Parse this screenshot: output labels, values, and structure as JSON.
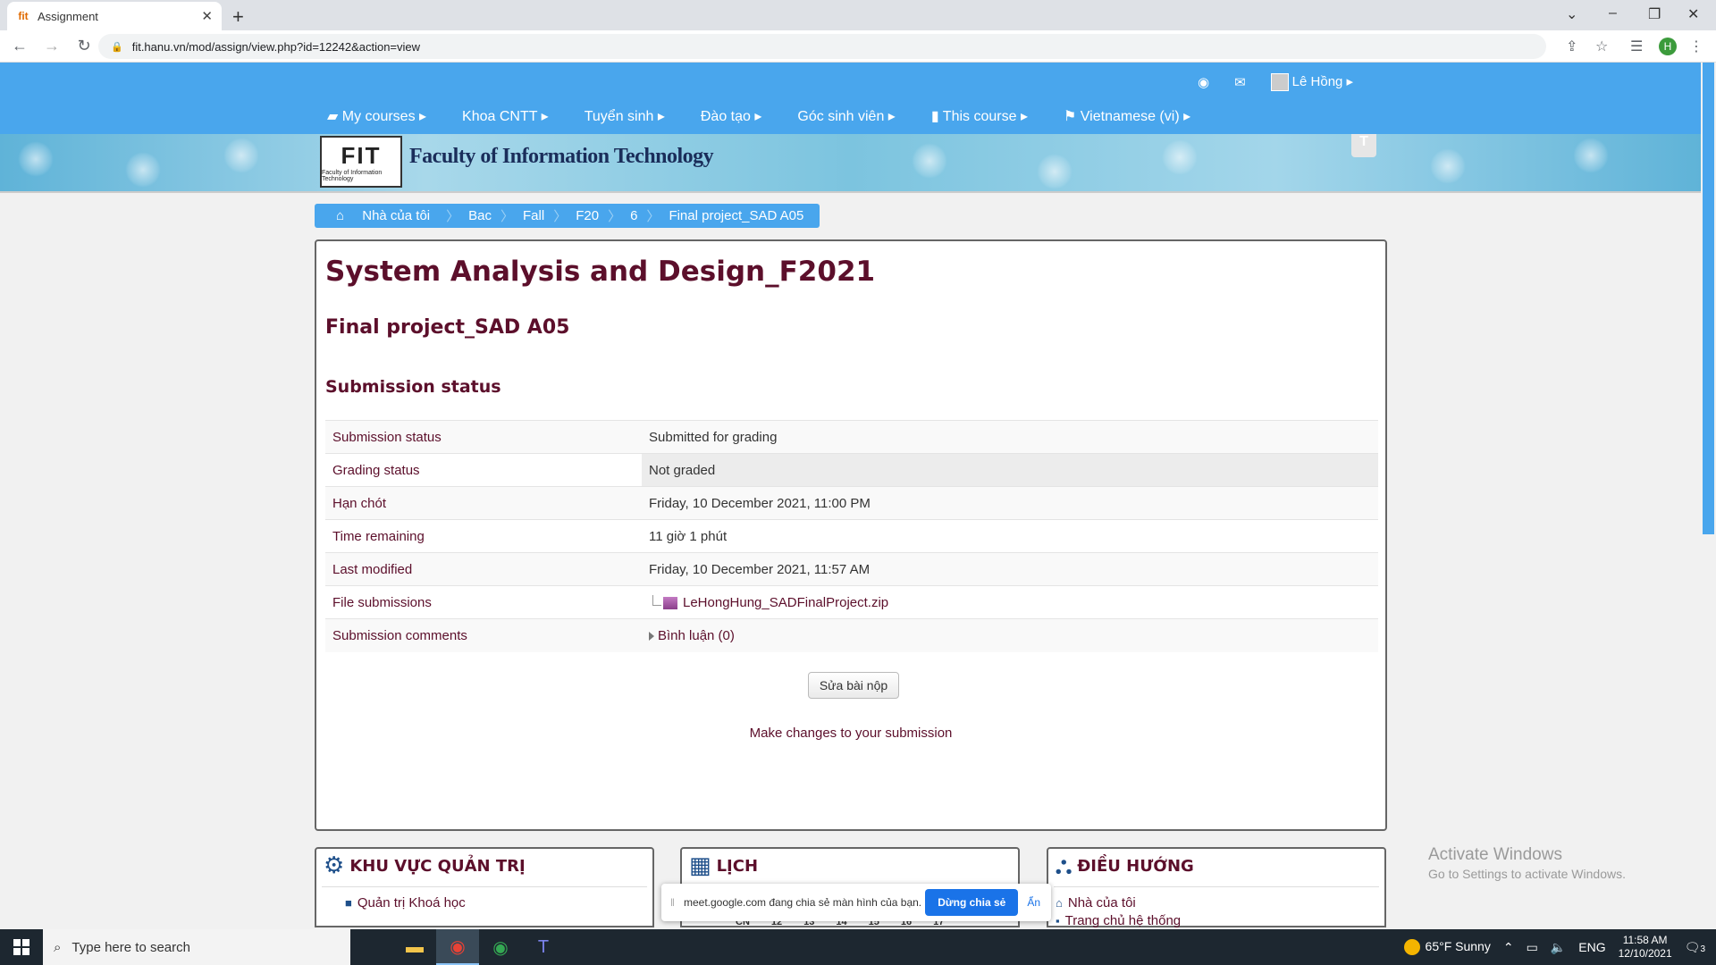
{
  "browser": {
    "tab_title": "Assignment",
    "tab_favicon": "fit-favicon",
    "url": "fit.hanu.vn/mod/assign/view.php?id=12242&action=view",
    "profile_initial": "H"
  },
  "header": {
    "user_name": "Lê Hồng",
    "menu": [
      "My courses",
      "Khoa CNTT",
      "Tuyển sinh",
      "Đào tạo",
      "Góc sinh viên",
      "This course",
      "Vietnamese (vi)"
    ],
    "logo_text": "FIT",
    "logo_sub": "Faculty of Information Technology",
    "logo_title": "Faculty of Information Technology"
  },
  "breadcrumb": [
    "Nhà của tôi",
    "Bac",
    "Fall",
    "F20",
    "6",
    "Final project_SAD A05"
  ],
  "main": {
    "course_title": "System Analysis and Design_F2021",
    "assignment_title": "Final project_SAD A05",
    "section_title": "Submission status",
    "rows": [
      {
        "key": "Submission status",
        "value": "Submitted for grading"
      },
      {
        "key": "Grading status",
        "value": "Not graded"
      },
      {
        "key": "Hạn chót",
        "value": "Friday, 10 December 2021, 11:00 PM"
      },
      {
        "key": "Time remaining",
        "value": "11 giờ 1 phút"
      },
      {
        "key": "Last modified",
        "value": "Friday, 10 December 2021, 11:57 AM"
      },
      {
        "key": "File submissions",
        "value": "LeHongHung_SADFinalProject.zip"
      },
      {
        "key": "Submission comments",
        "value": "Bình luận (0)"
      }
    ],
    "edit_button": "Sửa bài nộp",
    "make_changes": "Make changes to your submission"
  },
  "blocks": {
    "admin": {
      "title": "KHU VỰC QUẢN TRỊ",
      "item": "Quản trị Khoá học"
    },
    "calendar": {
      "title": "LỊCH",
      "days": [
        "CN",
        "12",
        "13",
        "14",
        "15",
        "16",
        "17"
      ]
    },
    "nav": {
      "title": "ĐIỀU HƯỚNG",
      "items": [
        "Nhà của tôi",
        "Trang chủ hệ thống"
      ]
    }
  },
  "meet": {
    "text": "meet.google.com đang chia sẻ màn hình của bạn.",
    "stop": "Dừng chia sẻ",
    "hide": "Ẩn"
  },
  "activate": {
    "line1": "Activate Windows",
    "line2": "Go to Settings to activate Windows."
  },
  "taskbar": {
    "search_placeholder": "Type here to search",
    "weather": "65°F  Sunny",
    "lang": "ENG",
    "time": "11:58 AM",
    "date": "12/10/2021",
    "notifications": "3"
  },
  "colors": {
    "header_blue": "#49a6ed",
    "title_maroon": "#5c0f2b"
  }
}
